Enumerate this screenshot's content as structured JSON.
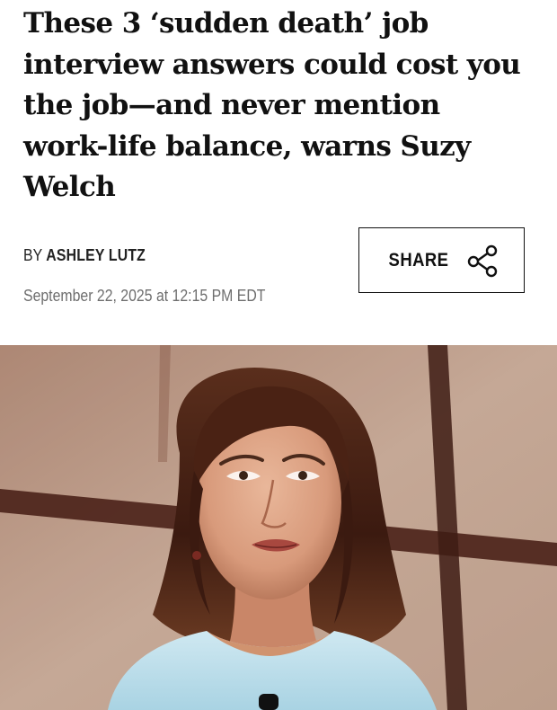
{
  "article": {
    "headline_lines": [
      "These 3 ‘sudden death’ job",
      "interview answers could cost you",
      "the job—and never mention",
      "work-life balance, warns Suzy",
      "Welch"
    ],
    "byline_prefix": "BY",
    "author": "ASHLEY LUTZ",
    "date": "September 22, 2025 at 12:15 PM EDT"
  },
  "share": {
    "label": "SHARE",
    "icon": "share-icon"
  },
  "hero_image": {
    "subject": "woman with shoulder-length brown hair speaking at microphone"
  },
  "colors": {
    "text": "#111111",
    "muted": "#6e6e6e",
    "background": "#ffffff",
    "photo_wall": "#c7a48e",
    "photo_beam": "#4a2118"
  }
}
